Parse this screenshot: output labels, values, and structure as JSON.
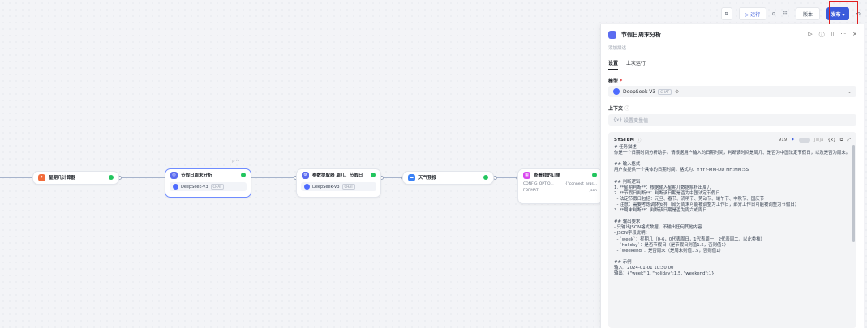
{
  "toolbar": {
    "run_label": "▷ 运行",
    "debug_icon": "⊙",
    "menu_icon": "☷",
    "version_label": "版本",
    "publish_label": "发布 ▾",
    "history_icon": "⟲"
  },
  "nodes": [
    {
      "title": "星期几计算器",
      "color": "#f26b3a",
      "icon": "✦"
    },
    {
      "title": "节假日周末分析",
      "color": "#5b6cf0",
      "icon": "◎",
      "model": "DeepSeek-V3",
      "tag": "CHAT",
      "toolbar": "▷ ···"
    },
    {
      "title": "参数提取器 周几、节假日",
      "color": "#5b6cf0",
      "icon": "⚙",
      "model": "DeepSeek-V3",
      "tag": "CHAT"
    },
    {
      "title": "天气预报",
      "color": "#3b82f6",
      "icon": "☁"
    },
    {
      "title": "查看我的订单",
      "color": "#d946ef",
      "icon": "▦",
      "rows": [
        [
          "CONFIG_OPTIO...",
          "{\"connect_args..."
        ],
        [
          "FORMAT",
          "json"
        ]
      ]
    }
  ],
  "panel": {
    "title": "节假日周末分析",
    "description_placeholder": "添加描述...",
    "tabs": [
      "设置",
      "上次运行"
    ],
    "model_label": "模型",
    "model_value": "DeepSeek-V3",
    "model_tag": "CHAT",
    "context_label": "上下文",
    "context_placeholder": "设置变量值",
    "system_label": "SYSTEM",
    "token_count": "919",
    "jinja_label": "Jinja",
    "prompt": "# 任务描述\n你是一个日期时间分析助手。请根据用户输入的日期时间，判断该时间是周几、是否为中国法定节假日，以及是否为周末。\n\n## 输入格式\n用户会提供一个具体的日期时间，格式为：YYYY-MM-DD HH:MM:SS\n\n## 判断逻辑\n1. **星期判断**：根据输入星期几数据解析出周几\n2. **节假日判断**：判断该日期是否为中国法定节假日\n  - 法定节假日包括：元旦、春节、清明节、劳动节、端午节、中秋节、国庆节\n  - 注意：需要考虑调休安排（部分周末可能被调整为工作日，部分工作日可能被调整为节假日）\n3. **周末判断**：判断该日期是否为周六或周日\n\n## 输出要求\n- 只输出JSON格式数据，不输出任何其他内容\n- JSON字段说明：\n  - `week`：星期几（0-6，0代表周日，1代表周一，2代表周二，以此类推）\n  - `holiday`：是否节假日（是节假日则值1.5，否则值1）\n  - `weekend`：是否周末（是周末则值1.5，否则值1）\n\n## 示例\n输入：2024-01-01 10:30:00\n输出：{\"week\":1, \"holiday\":1.5, \"weekend\":1}"
  }
}
